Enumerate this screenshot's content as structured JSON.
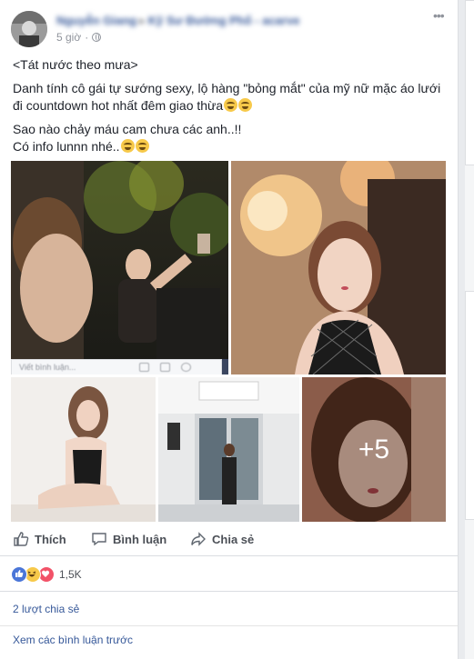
{
  "post": {
    "author": "Nguyễn Giang",
    "group": "Kỹ Sư Đường Phố - acarve",
    "time": "5 giờ",
    "menu_icon": "ellipsis-icon",
    "privacy_icon": "globe-icon",
    "text_lines": [
      "<Tát nước theo mưa>",
      "Danh tính cô gái tự sướng sexy, lộ hàng \"bỏng mắt\" của mỹ nữ mặc áo lưới đi countdown hot nhất đêm giao thừa",
      "Sao nào chảy máu cam chưa các anh..!!",
      "Có info lunnn nhé.."
    ],
    "extra_photos": "+5",
    "comment_placeholder": "Viết bình luận..."
  },
  "actions": {
    "like": "Thích",
    "comment": "Bình luận",
    "share": "Chia sẻ"
  },
  "reactions": {
    "count": "1,5K",
    "types": [
      "like",
      "haha",
      "love"
    ],
    "colors": {
      "like": "#4a76d8",
      "haha": "#f7c94a",
      "love": "#f25268"
    }
  },
  "shares_text": "2 lượt chia sẻ",
  "previous_comments": "Xem các bình luận trước"
}
